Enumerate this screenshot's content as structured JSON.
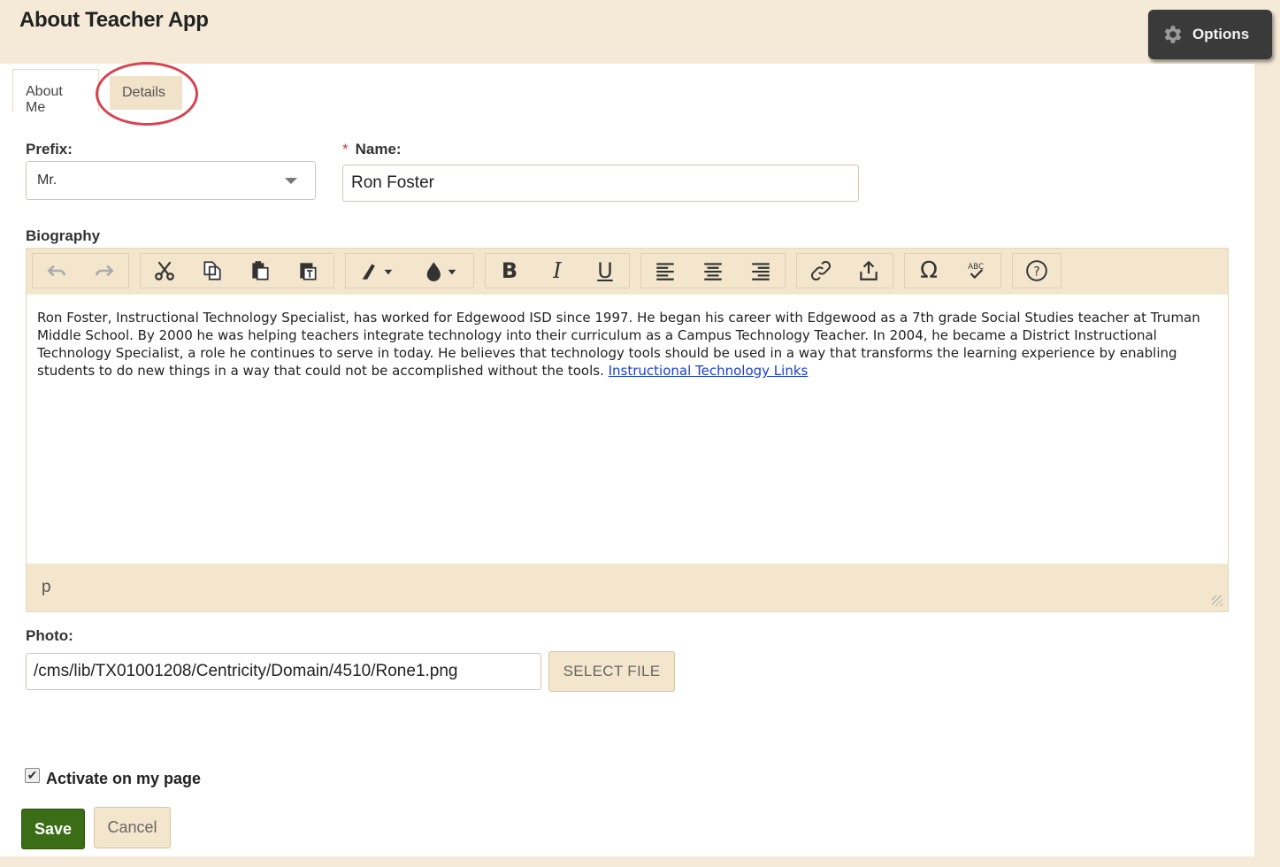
{
  "header": {
    "title": "About Teacher App",
    "options_label": "Options"
  },
  "tabs": [
    {
      "label": "About Me",
      "active": true
    },
    {
      "label": "Details",
      "active": false
    }
  ],
  "form": {
    "prefix_label": "Prefix:",
    "prefix_value": "Mr.",
    "name_required_mark": "*",
    "name_label": "Name:",
    "name_value": "Ron Foster",
    "biography_label": "Biography",
    "biography_text": "Ron Foster, Instructional Technology Specialist, has worked for Edgewood ISD since 1997.  He began his career with Edgewood as a 7th grade Social Studies teacher at Truman Middle School. By 2000 he was helping teachers integrate technology into their curriculum as a Campus Technology Teacher. In 2004, he became a District Instructional Technology Specialist, a role he continues to serve in today.  He believes that technology tools should be used in a way that transforms the learning experience by enabling students to do new things in a way that could not be accomplished without the tools. ",
    "biography_link": "Instructional Technology Links",
    "editor_path": "p",
    "photo_label": "Photo:",
    "photo_value": "/cms/lib/TX01001208/Centricity/Domain/4510/Rone1.png",
    "select_file_label": "SELECT FILE",
    "activate_label": "Activate on my page",
    "activate_checked": true,
    "save_label": "Save",
    "cancel_label": "Cancel"
  },
  "toolbar": {
    "groups": [
      [
        "undo-icon",
        "redo-icon"
      ],
      [
        "cut-icon",
        "copy-icon",
        "paste-icon",
        "paste-text-icon"
      ],
      [
        "highlight-color-icon",
        "text-color-icon"
      ],
      [
        "bold-icon",
        "italic-icon",
        "underline-icon"
      ],
      [
        "align-left-icon",
        "align-center-icon",
        "align-right-icon"
      ],
      [
        "link-icon",
        "upload-icon"
      ],
      [
        "special-char-icon",
        "spellcheck-icon"
      ],
      [
        "help-icon"
      ]
    ]
  },
  "colors": {
    "background": "#f5ead7",
    "save_green": "#3b6c16",
    "highlight_ring": "#d9424f",
    "link_blue": "#1a3fd6"
  }
}
